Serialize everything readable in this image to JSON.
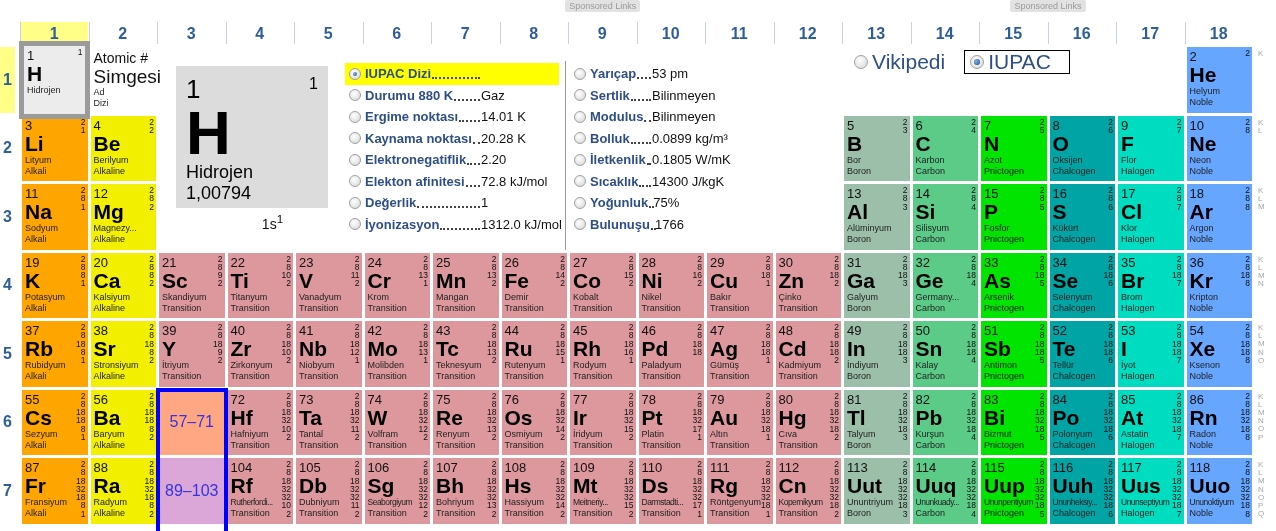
{
  "sponsored_links": [
    "Sponsored Links",
    "Sponsored Links"
  ],
  "groups": [
    {
      "label": "1",
      "selected": true
    },
    {
      "label": "2",
      "selected": false
    },
    {
      "label": "3",
      "selected": false
    },
    {
      "label": "4",
      "selected": false
    },
    {
      "label": "5",
      "selected": false
    },
    {
      "label": "6",
      "selected": false
    },
    {
      "label": "7",
      "selected": false
    },
    {
      "label": "8",
      "selected": false
    },
    {
      "label": "9",
      "selected": false
    },
    {
      "label": "10",
      "selected": false
    },
    {
      "label": "11",
      "selected": false
    },
    {
      "label": "12",
      "selected": false
    },
    {
      "label": "13",
      "selected": false
    },
    {
      "label": "14",
      "selected": false
    },
    {
      "label": "15",
      "selected": false
    },
    {
      "label": "16",
      "selected": false
    },
    {
      "label": "17",
      "selected": false
    },
    {
      "label": "18",
      "selected": false
    }
  ],
  "legend": {
    "number": "Atomic #",
    "symbol": "Simgesi",
    "name": "Ad",
    "category": "Dizi"
  },
  "detail": {
    "number": "1",
    "shells": "1",
    "symbol": "H",
    "name": "Hidrojen",
    "mass": "1,00794",
    "configuration": "1s$^{1}$"
  },
  "property_columns": [
    [
      {
        "label": "IUPAC Dizi",
        "selected": true
      },
      {
        "label": "Durumu 880 K",
        "value": "Gaz",
        "selected": false
      },
      {
        "label": "Ergime noktası",
        "value": "14.01 K",
        "selected": false
      },
      {
        "label": "Kaynama noktası",
        "value": "20.28 K",
        "selected": false
      },
      {
        "label": "Elektronegatiflik",
        "value": "2.20",
        "selected": false
      },
      {
        "label": "Elekton afinitesi",
        "value": "72.8 kJ/mol",
        "selected": false
      },
      {
        "label": "Değerlik",
        "value": "1",
        "selected": false
      },
      {
        "label": "İyonizasyon",
        "value": "1312.0 kJ/mol",
        "selected": false
      }
    ],
    [
      {
        "label": "Yarıçap",
        "value": "53 pm",
        "selected": false
      },
      {
        "label": "Sertlik",
        "value": "Bilinmeyen",
        "selected": false
      },
      {
        "label": "Modulus",
        "value": "Bilinmeyen",
        "selected": false
      },
      {
        "label": "Bolluk",
        "value": "0.0899 kg/m³",
        "selected": false
      },
      {
        "label": "İletkenlik",
        "value": "0.1805 W/mK",
        "selected": false
      },
      {
        "label": "Sıcaklık",
        "value": "14300 J/kgK",
        "selected": false
      },
      {
        "label": "Yoğunluk",
        "value": "75%",
        "selected": false
      },
      {
        "label": "Bulunuşu",
        "value": "1766",
        "selected": false
      }
    ]
  ],
  "sources": [
    {
      "label": "Vikipedi",
      "selected": false
    },
    {
      "label": "IUPAC",
      "selected": true
    }
  ],
  "periods": [
    {
      "label": "1",
      "selected": true,
      "shell_letters": [
        "K"
      ],
      "elements": [
        {
          "number": "1",
          "symbol": "H",
          "name": "Hidrojen",
          "shells": [
            "1"
          ],
          "color": "#ececec",
          "selected": true
        },
        {
          "number": "2",
          "symbol": "He",
          "name": "Helyum",
          "category": "Noble",
          "shells": [
            "2"
          ],
          "color": "#66a6ff",
          "selected": false
        }
      ]
    },
    {
      "label": "2",
      "selected": false,
      "shell_letters": [
        "K",
        "L"
      ],
      "elements": [
        {
          "number": "3",
          "symbol": "Li",
          "name": "Lityum",
          "category": "Alkali",
          "shells": [
            "2",
            "1"
          ],
          "color": "#ffa500",
          "selected": false
        },
        {
          "number": "4",
          "symbol": "Be",
          "name": "Berilyum",
          "category": "Alkaline",
          "shells": [
            "2",
            "2"
          ],
          "color": "#f2f000",
          "selected": false
        },
        {
          "number": "5",
          "symbol": "B",
          "name": "Bor",
          "category": "Boron",
          "shells": [
            "2",
            "3"
          ],
          "color": "#9cbfa9",
          "selected": false
        },
        {
          "number": "6",
          "symbol": "C",
          "name": "Karbon",
          "category": "Carbon",
          "shells": [
            "2",
            "4"
          ],
          "color": "#5ccb87",
          "selected": false
        },
        {
          "number": "7",
          "symbol": "N",
          "name": "Azot",
          "category": "Pnictogen",
          "shells": [
            "2",
            "5"
          ],
          "color": "#00e400",
          "selected": false
        },
        {
          "number": "8",
          "symbol": "O",
          "name": "Oksijen",
          "category": "Chalcogen",
          "shells": [
            "2",
            "6"
          ],
          "color": "#00a4a4",
          "selected": false
        },
        {
          "number": "9",
          "symbol": "F",
          "name": "Flor",
          "category": "Halogen",
          "shells": [
            "2",
            "7"
          ],
          "color": "#00dcc0",
          "selected": false
        },
        {
          "number": "10",
          "symbol": "Ne",
          "name": "Neon",
          "category": "Noble",
          "shells": [
            "2",
            "8"
          ],
          "color": "#66a6ff",
          "selected": false
        }
      ]
    },
    {
      "label": "3",
      "selected": false,
      "shell_letters": [
        "K",
        "L",
        "M"
      ],
      "elements": [
        {
          "number": "11",
          "symbol": "Na",
          "name": "Sodyum",
          "category": "Alkali",
          "shells": [
            "2",
            "8",
            "1"
          ],
          "color": "#ffa500",
          "selected": false
        },
        {
          "number": "12",
          "symbol": "Mg",
          "name": "Magnezy...",
          "category": "Alkaline",
          "shells": [
            "2",
            "8",
            "2"
          ],
          "color": "#f2f000",
          "selected": false
        },
        {
          "number": "13",
          "symbol": "Al",
          "name": "Alüminyum",
          "category": "Boron",
          "shells": [
            "2",
            "8",
            "3"
          ],
          "color": "#9cbfa9",
          "selected": false
        },
        {
          "number": "14",
          "symbol": "Si",
          "name": "Silisyum",
          "category": "Carbon",
          "shells": [
            "2",
            "8",
            "4"
          ],
          "color": "#5ccb87",
          "selected": false
        },
        {
          "number": "15",
          "symbol": "P",
          "name": "Fosfor",
          "category": "Pnictogen",
          "shells": [
            "2",
            "8",
            "5"
          ],
          "color": "#00e400",
          "selected": false
        },
        {
          "number": "16",
          "symbol": "S",
          "name": "Kükürt",
          "category": "Chalcogen",
          "shells": [
            "2",
            "8",
            "6"
          ],
          "color": "#00a4a4",
          "selected": false
        },
        {
          "number": "17",
          "symbol": "Cl",
          "name": "Klor",
          "category": "Halogen",
          "shells": [
            "2",
            "8",
            "7"
          ],
          "color": "#00dcc0",
          "selected": false
        },
        {
          "number": "18",
          "symbol": "Ar",
          "name": "Argon",
          "category": "Noble",
          "shells": [
            "2",
            "8",
            "8"
          ],
          "color": "#66a6ff",
          "selected": false
        }
      ]
    },
    {
      "label": "4",
      "selected": false,
      "shell_letters": [
        "K",
        "L",
        "M",
        "N"
      ],
      "elements": [
        {
          "number": "19",
          "symbol": "K",
          "name": "Potasyum",
          "category": "Alkali",
          "shells": [
            "2",
            "8",
            "8",
            "1"
          ],
          "color": "#ffa500",
          "selected": false
        },
        {
          "number": "20",
          "symbol": "Ca",
          "name": "Kalsiyum",
          "category": "Alkaline",
          "shells": [
            "2",
            "8",
            "8",
            "2"
          ],
          "color": "#f2f000",
          "selected": false
        },
        {
          "number": "21",
          "symbol": "Sc",
          "name": "Skandiyum",
          "category": "Transition",
          "shells": [
            "2",
            "8",
            "9",
            "2"
          ],
          "color": "#dc989c",
          "selected": false
        },
        {
          "number": "22",
          "symbol": "Ti",
          "name": "Titanyum",
          "category": "Transition",
          "shells": [
            "2",
            "8",
            "10",
            "2"
          ],
          "color": "#dc989c",
          "selected": false
        },
        {
          "number": "23",
          "symbol": "V",
          "name": "Vanadyum",
          "category": "Transition",
          "shells": [
            "2",
            "8",
            "11",
            "2"
          ],
          "color": "#dc989c",
          "selected": false
        },
        {
          "number": "24",
          "symbol": "Cr",
          "name": "Krom",
          "category": "Transition",
          "shells": [
            "2",
            "8",
            "13",
            "1"
          ],
          "color": "#dc989c",
          "selected": false
        },
        {
          "number": "25",
          "symbol": "Mn",
          "name": "Mangan",
          "category": "Transition",
          "shells": [
            "2",
            "8",
            "13",
            "2"
          ],
          "color": "#dc989c",
          "selected": false
        },
        {
          "number": "26",
          "symbol": "Fe",
          "name": "Demir",
          "category": "Transition",
          "shells": [
            "2",
            "8",
            "14",
            "2"
          ],
          "color": "#dc989c",
          "selected": false
        },
        {
          "number": "27",
          "symbol": "Co",
          "name": "Kobalt",
          "category": "Transition",
          "shells": [
            "2",
            "8",
            "15",
            "2"
          ],
          "color": "#dc989c",
          "selected": false
        },
        {
          "number": "28",
          "symbol": "Ni",
          "name": "Nikel",
          "category": "Transition",
          "shells": [
            "2",
            "8",
            "16",
            "2"
          ],
          "color": "#dc989c",
          "selected": false
        },
        {
          "number": "29",
          "symbol": "Cu",
          "name": "Bakır",
          "category": "Transition",
          "shells": [
            "2",
            "8",
            "18",
            "1"
          ],
          "color": "#dc989c",
          "selected": false
        },
        {
          "number": "30",
          "symbol": "Zn",
          "name": "Çinko",
          "category": "Transition",
          "shells": [
            "2",
            "8",
            "18",
            "2"
          ],
          "color": "#dc989c",
          "selected": false
        },
        {
          "number": "31",
          "symbol": "Ga",
          "name": "Galyum",
          "category": "Boron",
          "shells": [
            "2",
            "8",
            "18",
            "3"
          ],
          "color": "#9cbfa9",
          "selected": false
        },
        {
          "number": "32",
          "symbol": "Ge",
          "name": "Germany...",
          "category": "Carbon",
          "shells": [
            "2",
            "8",
            "18",
            "4"
          ],
          "color": "#5ccb87",
          "selected": false
        },
        {
          "number": "33",
          "symbol": "As",
          "name": "Arsenik",
          "category": "Pnictogen",
          "shells": [
            "2",
            "8",
            "18",
            "5"
          ],
          "color": "#00e400",
          "selected": false
        },
        {
          "number": "34",
          "symbol": "Se",
          "name": "Selenyum",
          "category": "Chalcogen",
          "shells": [
            "2",
            "8",
            "18",
            "6"
          ],
          "color": "#00a4a4",
          "selected": false
        },
        {
          "number": "35",
          "symbol": "Br",
          "name": "Brom",
          "category": "Halogen",
          "shells": [
            "2",
            "8",
            "18",
            "7"
          ],
          "color": "#00dcc0",
          "selected": false
        },
        {
          "number": "36",
          "symbol": "Kr",
          "name": "Kripton",
          "category": "Noble",
          "shells": [
            "2",
            "8",
            "18",
            "8"
          ],
          "color": "#66a6ff",
          "selected": false
        }
      ]
    },
    {
      "label": "5",
      "selected": false,
      "shell_letters": [
        "K",
        "L",
        "M",
        "N",
        "O"
      ],
      "elements": [
        {
          "number": "37",
          "symbol": "Rb",
          "name": "Rubidyum",
          "category": "Alkali",
          "shells": [
            "2",
            "8",
            "18",
            "8",
            "1"
          ],
          "color": "#ffa500",
          "selected": false
        },
        {
          "number": "38",
          "symbol": "Sr",
          "name": "Stronsiyum",
          "category": "Alkaline",
          "shells": [
            "2",
            "8",
            "18",
            "8",
            "2"
          ],
          "color": "#f2f000",
          "selected": false
        },
        {
          "number": "39",
          "symbol": "Y",
          "name": "İtriyum",
          "category": "Transition",
          "shells": [
            "2",
            "8",
            "18",
            "9",
            "2"
          ],
          "color": "#dc989c",
          "selected": false
        },
        {
          "number": "40",
          "symbol": "Zr",
          "name": "Zirkonyum",
          "category": "Transition",
          "shells": [
            "2",
            "8",
            "18",
            "10",
            "2"
          ],
          "color": "#dc989c",
          "selected": false
        },
        {
          "number": "41",
          "symbol": "Nb",
          "name": "Niobyum",
          "category": "Transition",
          "shells": [
            "2",
            "8",
            "18",
            "12",
            "1"
          ],
          "color": "#dc989c",
          "selected": false
        },
        {
          "number": "42",
          "symbol": "Mo",
          "name": "Molibden",
          "category": "Transition",
          "shells": [
            "2",
            "8",
            "18",
            "13",
            "1"
          ],
          "color": "#dc989c",
          "selected": false
        },
        {
          "number": "43",
          "symbol": "Tc",
          "name": "Teknesyum",
          "category": "Transition",
          "shells": [
            "2",
            "8",
            "18",
            "13",
            "2"
          ],
          "color": "#dc989c",
          "selected": false
        },
        {
          "number": "44",
          "symbol": "Ru",
          "name": "Rutenyum",
          "category": "Transition",
          "shells": [
            "2",
            "8",
            "18",
            "15",
            "1"
          ],
          "color": "#dc989c",
          "selected": false
        },
        {
          "number": "45",
          "symbol": "Rh",
          "name": "Rodyum",
          "category": "Transition",
          "shells": [
            "2",
            "8",
            "18",
            "16",
            "1"
          ],
          "color": "#dc989c",
          "selected": false
        },
        {
          "number": "46",
          "symbol": "Pd",
          "name": "Paladyum",
          "category": "Transition",
          "shells": [
            "2",
            "8",
            "18",
            "18"
          ],
          "color": "#dc989c",
          "selected": false
        },
        {
          "number": "47",
          "symbol": "Ag",
          "name": "Gümüş",
          "category": "Transition",
          "shells": [
            "2",
            "8",
            "18",
            "18",
            "1"
          ],
          "color": "#dc989c",
          "selected": false
        },
        {
          "number": "48",
          "symbol": "Cd",
          "name": "Kadmiyum",
          "category": "Transition",
          "shells": [
            "2",
            "8",
            "18",
            "18",
            "2"
          ],
          "color": "#dc989c",
          "selected": false
        },
        {
          "number": "49",
          "symbol": "In",
          "name": "İndiyum",
          "category": "Boron",
          "shells": [
            "2",
            "8",
            "18",
            "18",
            "3"
          ],
          "color": "#9cbfa9",
          "selected": false
        },
        {
          "number": "50",
          "symbol": "Sn",
          "name": "Kalay",
          "category": "Carbon",
          "shells": [
            "2",
            "8",
            "18",
            "18",
            "4"
          ],
          "color": "#5ccb87",
          "selected": false
        },
        {
          "number": "51",
          "symbol": "Sb",
          "name": "Antimon",
          "category": "Pnictogen",
          "shells": [
            "2",
            "8",
            "18",
            "18",
            "5"
          ],
          "color": "#00e400",
          "selected": false
        },
        {
          "number": "52",
          "symbol": "Te",
          "name": "Tellür",
          "category": "Chalcogen",
          "shells": [
            "2",
            "8",
            "18",
            "18",
            "6"
          ],
          "color": "#00a4a4",
          "selected": false
        },
        {
          "number": "53",
          "symbol": "I",
          "name": "İyot",
          "category": "Halogen",
          "shells": [
            "2",
            "8",
            "18",
            "18",
            "7"
          ],
          "color": "#00dcc0",
          "selected": false
        },
        {
          "number": "54",
          "symbol": "Xe",
          "name": "Ksenon",
          "category": "Noble",
          "shells": [
            "2",
            "8",
            "18",
            "18",
            "8"
          ],
          "color": "#66a6ff",
          "selected": false
        }
      ]
    },
    {
      "label": "6",
      "selected": false,
      "shell_letters": [
        "K",
        "L",
        "M",
        "N",
        "O",
        "P"
      ],
      "series": {
        "label": "57–71",
        "color": "#ffa783",
        "highlighted": true
      },
      "elements": [
        {
          "number": "55",
          "symbol": "Cs",
          "name": "Sezyum",
          "category": "Alkali",
          "shells": [
            "2",
            "8",
            "18",
            "18",
            "8",
            "1"
          ],
          "color": "#ffa500",
          "selected": false
        },
        {
          "number": "56",
          "symbol": "Ba",
          "name": "Baryum",
          "category": "Alkaline",
          "shells": [
            "2",
            "8",
            "18",
            "18",
            "8",
            "2"
          ],
          "color": "#f2f000",
          "selected": false
        },
        {
          "number": "72",
          "symbol": "Hf",
          "name": "Hafniyum",
          "category": "Transition",
          "shells": [
            "2",
            "8",
            "18",
            "32",
            "10",
            "2"
          ],
          "color": "#dc989c",
          "selected": false
        },
        {
          "number": "73",
          "symbol": "Ta",
          "name": "Tantal",
          "category": "Transition",
          "shells": [
            "2",
            "8",
            "18",
            "32",
            "11",
            "2"
          ],
          "color": "#dc989c",
          "selected": false
        },
        {
          "number": "74",
          "symbol": "W",
          "name": "Volfram",
          "category": "Transition",
          "shells": [
            "2",
            "8",
            "18",
            "32",
            "12",
            "2"
          ],
          "color": "#dc989c",
          "selected": false
        },
        {
          "number": "75",
          "symbol": "Re",
          "name": "Renyum",
          "category": "Transition",
          "shells": [
            "2",
            "8",
            "18",
            "32",
            "13",
            "2"
          ],
          "color": "#dc989c",
          "selected": false
        },
        {
          "number": "76",
          "symbol": "Os",
          "name": "Osmiyum",
          "category": "Transition",
          "shells": [
            "2",
            "8",
            "18",
            "32",
            "14",
            "2"
          ],
          "color": "#dc989c",
          "selected": false
        },
        {
          "number": "77",
          "symbol": "Ir",
          "name": "İridyum",
          "category": "Transition",
          "shells": [
            "2",
            "8",
            "18",
            "32",
            "15",
            "2"
          ],
          "color": "#dc989c",
          "selected": false
        },
        {
          "number": "78",
          "symbol": "Pt",
          "name": "Platin",
          "category": "Transition",
          "shells": [
            "2",
            "8",
            "18",
            "32",
            "17",
            "1"
          ],
          "color": "#dc989c",
          "selected": false
        },
        {
          "number": "79",
          "symbol": "Au",
          "name": "Altın",
          "category": "Transition",
          "shells": [
            "2",
            "8",
            "18",
            "32",
            "18",
            "1"
          ],
          "color": "#dc989c",
          "selected": false
        },
        {
          "number": "80",
          "symbol": "Hg",
          "name": "Cıva",
          "category": "Transition",
          "shells": [
            "2",
            "8",
            "18",
            "32",
            "18",
            "2"
          ],
          "color": "#dc989c",
          "selected": false
        },
        {
          "number": "81",
          "symbol": "Tl",
          "name": "Talyum",
          "category": "Boron",
          "shells": [
            "2",
            "8",
            "18",
            "32",
            "18",
            "3"
          ],
          "color": "#9cbfa9",
          "selected": false
        },
        {
          "number": "82",
          "symbol": "Pb",
          "name": "Kurşun",
          "category": "Carbon",
          "shells": [
            "2",
            "8",
            "18",
            "32",
            "18",
            "4"
          ],
          "color": "#5ccb87",
          "selected": false
        },
        {
          "number": "83",
          "symbol": "Bi",
          "name": "Bizmut",
          "category": "Pnictogen",
          "shells": [
            "2",
            "8",
            "18",
            "32",
            "18",
            "5"
          ],
          "color": "#00e400",
          "selected": false
        },
        {
          "number": "84",
          "symbol": "Po",
          "name": "Polonyum",
          "category": "Chalcogen",
          "shells": [
            "2",
            "8",
            "18",
            "32",
            "18",
            "6"
          ],
          "color": "#00a4a4",
          "selected": false
        },
        {
          "number": "85",
          "symbol": "At",
          "name": "Astatin",
          "category": "Halogen",
          "shells": [
            "2",
            "8",
            "18",
            "32",
            "18",
            "7"
          ],
          "color": "#00dcc0",
          "selected": false
        },
        {
          "number": "86",
          "symbol": "Rn",
          "name": "Radon",
          "category": "Noble",
          "shells": [
            "2",
            "8",
            "18",
            "32",
            "18",
            "8"
          ],
          "color": "#66a6ff",
          "selected": false
        }
      ]
    },
    {
      "label": "7",
      "selected": false,
      "shell_letters": [
        "K",
        "L",
        "M",
        "N",
        "O",
        "P",
        "Q"
      ],
      "series": {
        "label": "89–103",
        "color": "#dba6d8",
        "highlighted": true
      },
      "elements": [
        {
          "number": "87",
          "symbol": "Fr",
          "name": "Fransiyum",
          "category": "Alkali",
          "shells": [
            "2",
            "8",
            "18",
            "32",
            "18",
            "8",
            "1"
          ],
          "color": "#ffa500",
          "selected": false
        },
        {
          "number": "88",
          "symbol": "Ra",
          "name": "Radyum",
          "category": "Alkaline",
          "shells": [
            "2",
            "8",
            "18",
            "32",
            "18",
            "8",
            "2"
          ],
          "color": "#f2f000",
          "selected": false
        },
        {
          "number": "104",
          "symbol": "Rf",
          "name": "Rutherfordi...",
          "category": "Transition",
          "shells": [
            "2",
            "8",
            "18",
            "32",
            "32",
            "10",
            "2"
          ],
          "color": "#dc989c",
          "selected": false
        },
        {
          "number": "105",
          "symbol": "Db",
          "name": "Dubniyum",
          "category": "Transition",
          "shells": [
            "2",
            "8",
            "18",
            "32",
            "32",
            "11",
            "2"
          ],
          "color": "#dc989c",
          "selected": false
        },
        {
          "number": "106",
          "symbol": "Sg",
          "name": "Seaborgiyum",
          "category": "Transition",
          "shells": [
            "2",
            "8",
            "18",
            "32",
            "32",
            "12",
            "2"
          ],
          "color": "#dc989c",
          "selected": false
        },
        {
          "number": "107",
          "symbol": "Bh",
          "name": "Bohriyum",
          "category": "Transition",
          "shells": [
            "2",
            "8",
            "18",
            "32",
            "32",
            "13",
            "2"
          ],
          "color": "#dc989c",
          "selected": false
        },
        {
          "number": "108",
          "symbol": "Hs",
          "name": "Hassiyum",
          "category": "Transition",
          "shells": [
            "2",
            "8",
            "18",
            "32",
            "32",
            "14",
            "2"
          ],
          "color": "#dc989c",
          "selected": false
        },
        {
          "number": "109",
          "symbol": "Mt",
          "name": "Meitneriy...",
          "category": "Transition",
          "shells": [
            "2",
            "8",
            "18",
            "32",
            "32",
            "15",
            "2"
          ],
          "color": "#dc989c",
          "selected": false
        },
        {
          "number": "110",
          "symbol": "Ds",
          "name": "Darmstadti...",
          "category": "Transition",
          "shells": [
            "2",
            "8",
            "18",
            "32",
            "32",
            "17",
            "1"
          ],
          "color": "#dc989c",
          "selected": false
        },
        {
          "number": "111",
          "symbol": "Rg",
          "name": "Röntgenyum",
          "category": "Transition",
          "shells": [
            "2",
            "8",
            "18",
            "32",
            "32",
            "18",
            "1"
          ],
          "color": "#dc989c",
          "selected": false
        },
        {
          "number": "112",
          "symbol": "Cn",
          "name": "Kopernikyum",
          "category": "Transition",
          "shells": [
            "2",
            "8",
            "18",
            "32",
            "32",
            "18",
            "2"
          ],
          "color": "#dc989c",
          "selected": false
        },
        {
          "number": "113",
          "symbol": "Uut",
          "name": "Ununtriyum",
          "category": "Boron",
          "shells": [
            "2",
            "8",
            "18",
            "32",
            "32",
            "18",
            "3"
          ],
          "color": "#9cbfa9",
          "selected": false
        },
        {
          "number": "114",
          "symbol": "Uuq",
          "name": "Ununkuady...",
          "category": "Carbon",
          "shells": [
            "2",
            "8",
            "18",
            "32",
            "32",
            "18",
            "4"
          ],
          "color": "#5ccb87",
          "selected": false
        },
        {
          "number": "115",
          "symbol": "Uup",
          "name": "Ununpentiyum",
          "category": "Pnictogen",
          "shells": [
            "2",
            "8",
            "18",
            "32",
            "32",
            "18",
            "5"
          ],
          "color": "#00e400",
          "selected": false
        },
        {
          "number": "116",
          "symbol": "Uuh",
          "name": "Ununheksiy...",
          "category": "Chalcogen",
          "shells": [
            "2",
            "8",
            "18",
            "32",
            "32",
            "18",
            "6"
          ],
          "color": "#00a4a4",
          "selected": false
        },
        {
          "number": "117",
          "symbol": "Uus",
          "name": "Ununseptiyum",
          "category": "Halogen",
          "shells": [
            "2",
            "8",
            "18",
            "32",
            "32",
            "18",
            "7"
          ],
          "color": "#00dcc0",
          "selected": false
        },
        {
          "number": "118",
          "symbol": "Uuo",
          "name": "Ununoktiyum",
          "category": "Noble",
          "shells": [
            "2",
            "8",
            "18",
            "32",
            "32",
            "18",
            "8"
          ],
          "color": "#66a6ff",
          "selected": false
        }
      ]
    }
  ]
}
